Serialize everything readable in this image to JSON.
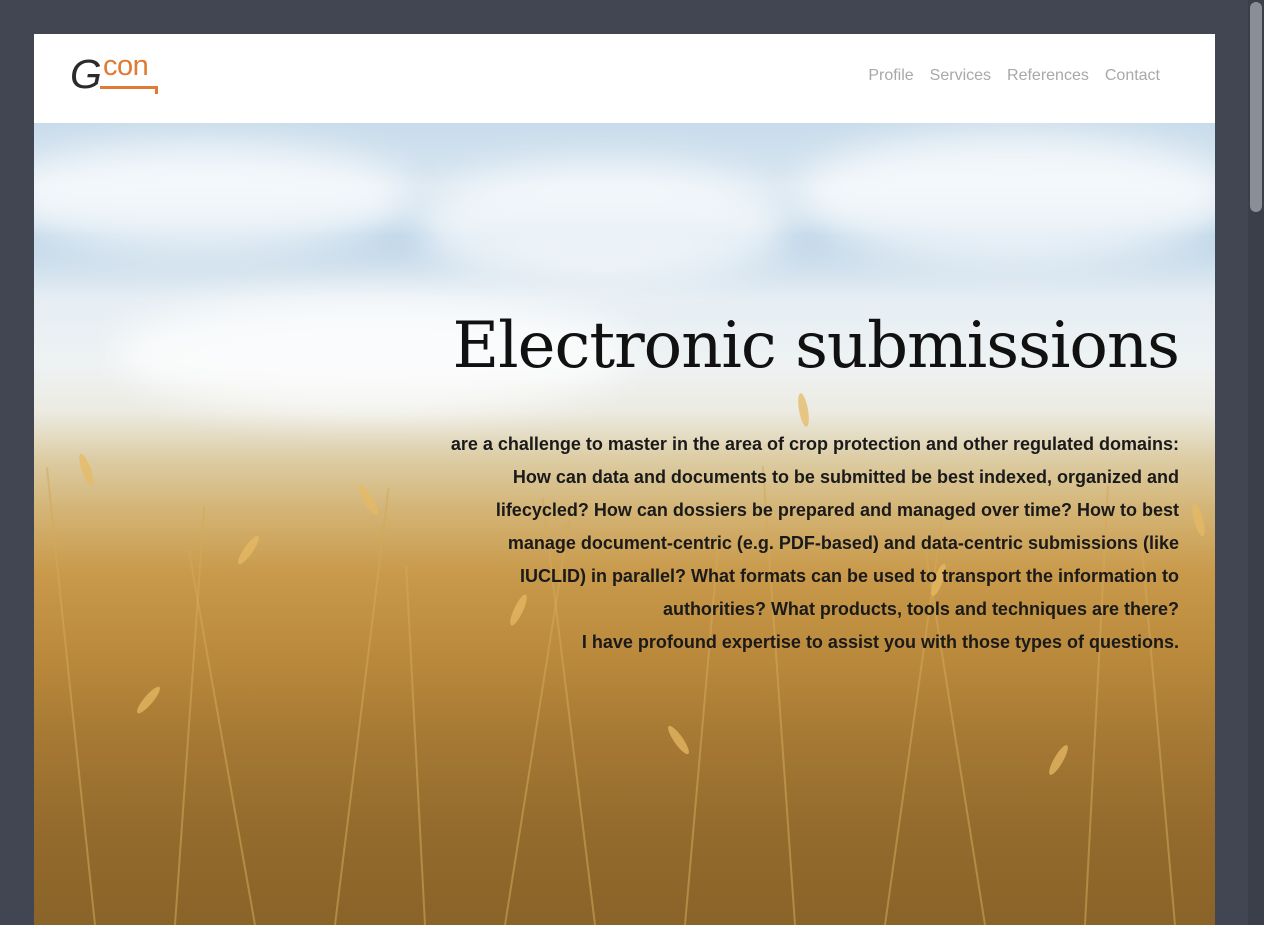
{
  "logo": {
    "letter": "G",
    "suffix": "con"
  },
  "nav": {
    "items": [
      {
        "label": "Profile"
      },
      {
        "label": "Services"
      },
      {
        "label": "References"
      },
      {
        "label": "Contact"
      }
    ]
  },
  "hero": {
    "title": "Electronic submissions",
    "text": "are a challenge to master in the area of crop protection and other regulated domains: How can data and documents to be submitted be best indexed, organized and lifecycled? How can dossiers be prepared and managed over time? How to best manage document-centric (e.g. PDF-based) and data-centric submissions (like IUCLID) in parallel? What formats can be used to transport the information to authorities? What products, tools and techniques are there?",
    "text2": "I have profound expertise to assist you with those types of questions."
  },
  "colors": {
    "background": "#414652",
    "accent": "#e07a35",
    "nav_text": "#a8a8a8"
  }
}
